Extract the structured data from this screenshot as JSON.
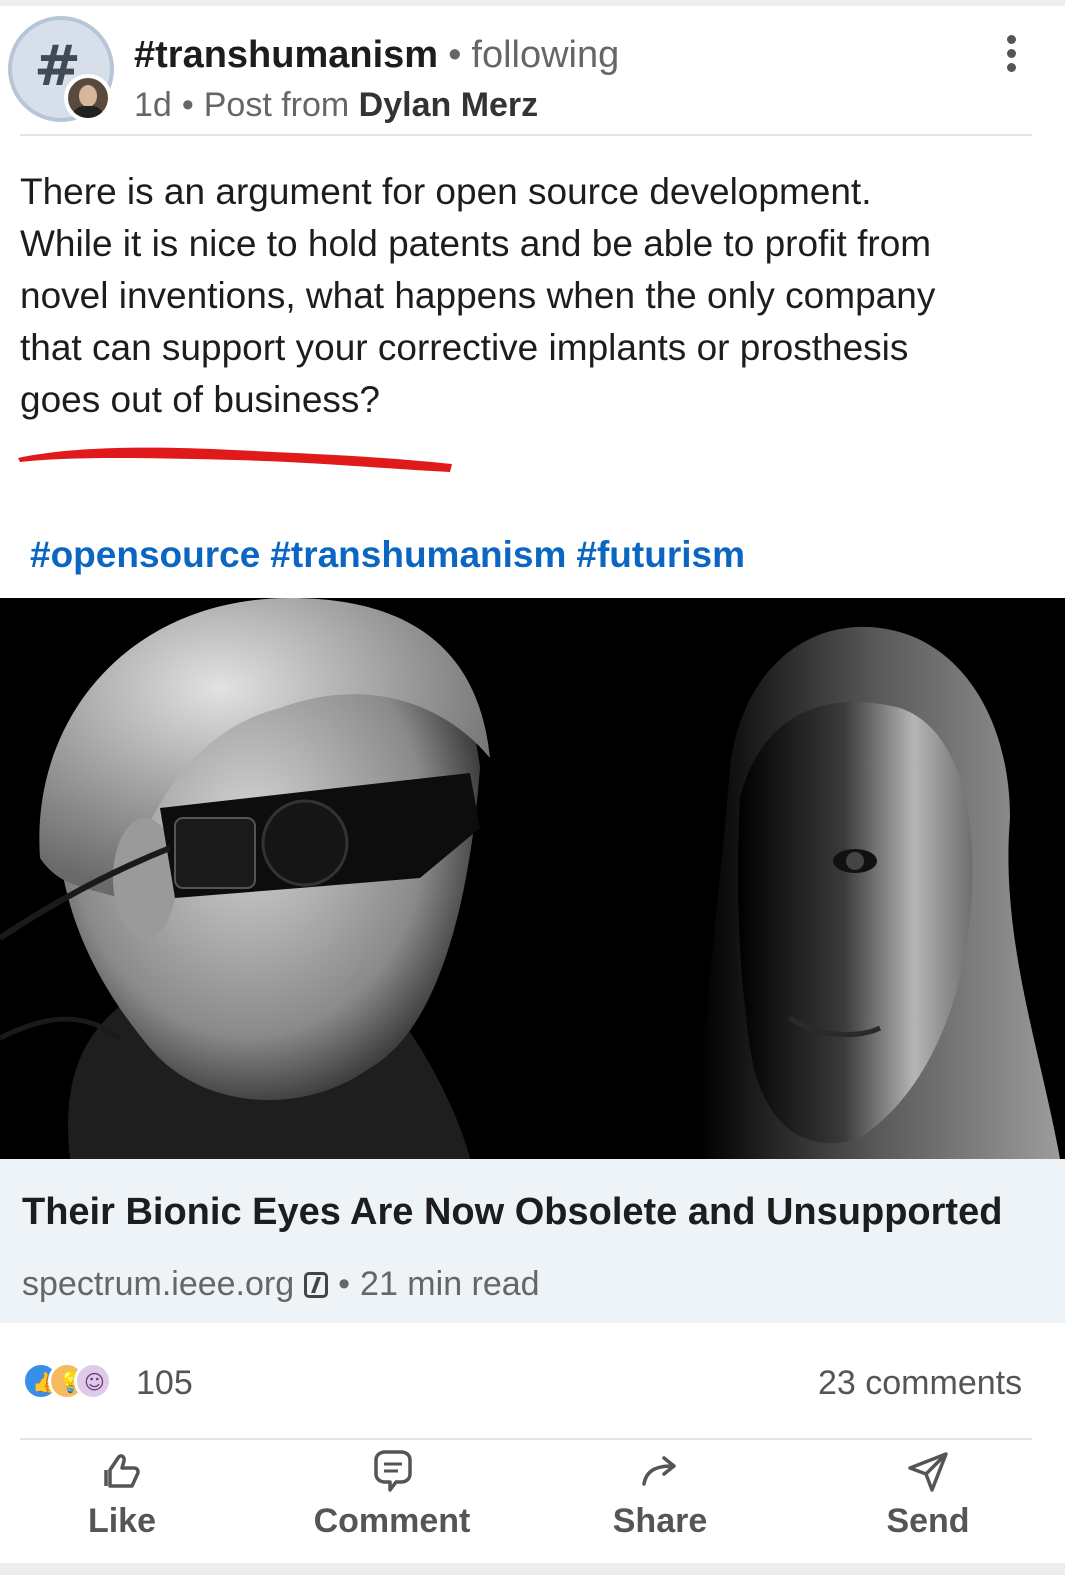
{
  "header": {
    "hashtag": "#transhumanism",
    "separator": "•",
    "following": "following",
    "age": "1d",
    "post_from": "Post from",
    "author": "Dylan Merz"
  },
  "post": {
    "text_lines": [
      "There is an argument for open source development.",
      "While it is nice to hold patents and be able to profit from",
      "novel inventions, what happens when the only company",
      "that can support your corrective implants or prosthesis",
      "goes out of business?"
    ],
    "hashtags": [
      "#opensource",
      "#transhumanism",
      "#futurism"
    ],
    "underline_color": "#e0191b"
  },
  "link": {
    "title": "Their Bionic Eyes Are Now Obsolete and Unsupported",
    "domain": "spectrum.ieee.org",
    "read_time": "21 min read",
    "separator": "•"
  },
  "social": {
    "reaction_count": "105",
    "comments": "23 comments",
    "reaction_icons": [
      "like-icon",
      "insightful-icon",
      "curious-icon"
    ]
  },
  "actions": {
    "like": "Like",
    "comment": "Comment",
    "share": "Share",
    "send": "Send"
  },
  "colors": {
    "link_blue": "#0a66c2",
    "link_bg": "#eef3f8",
    "muted_text": "#666666"
  }
}
